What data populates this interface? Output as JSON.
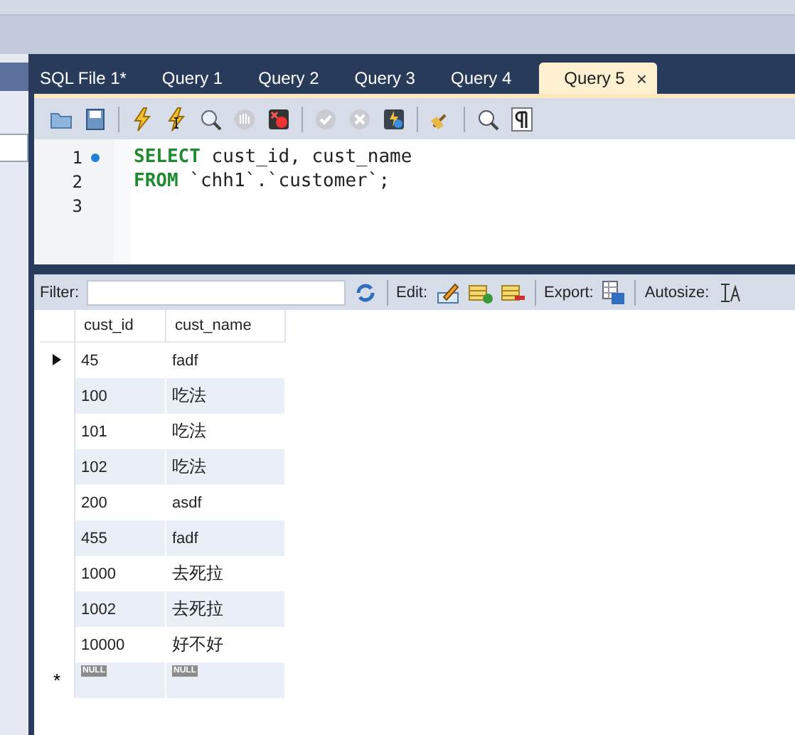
{
  "tabs": [
    {
      "label": "SQL File 1*",
      "selected": false
    },
    {
      "label": "Query 1",
      "selected": false
    },
    {
      "label": "Query 2",
      "selected": false
    },
    {
      "label": "Query 3",
      "selected": false
    },
    {
      "label": "Query 4",
      "selected": false
    },
    {
      "label": "Query 5",
      "selected": true,
      "close": "×"
    }
  ],
  "editor": {
    "lines": [
      {
        "number": "1",
        "marker": true,
        "tokens": [
          {
            "kind": "keyword",
            "text": "SELECT"
          },
          {
            "kind": "plain",
            "text": " cust_id, cust_name"
          }
        ]
      },
      {
        "number": "2",
        "marker": false,
        "tokens": [
          {
            "kind": "keyword",
            "text": "FROM"
          },
          {
            "kind": "plain",
            "text": " `chh1`.`customer`;"
          }
        ]
      },
      {
        "number": "3",
        "marker": false
      }
    ]
  },
  "results_toolbar": {
    "filter_label": "Filter:",
    "edit_label": "Edit:",
    "export_label": "Export:",
    "autosize_label": "Autosize:"
  },
  "table": {
    "columns": [
      "cust_id",
      "cust_name"
    ],
    "rows": [
      {
        "cells": [
          "45",
          "fadf"
        ],
        "selected": true
      },
      {
        "cells": [
          "100",
          "吃法"
        ],
        "selected": false
      },
      {
        "cells": [
          "101",
          "吃法"
        ],
        "selected": false
      },
      {
        "cells": [
          "102",
          "吃法"
        ],
        "selected": false
      },
      {
        "cells": [
          "200",
          "asdf"
        ],
        "selected": false
      },
      {
        "cells": [
          "455",
          "fadf"
        ],
        "selected": false
      },
      {
        "cells": [
          "1000",
          "去死拉"
        ],
        "selected": false
      },
      {
        "cells": [
          "1002",
          "去死拉"
        ],
        "selected": false
      },
      {
        "cells": [
          "10000",
          "好不好"
        ],
        "selected": false
      }
    ],
    "new_row": {
      "marker": "*",
      "cells": [
        "NULL",
        "NULL"
      ]
    }
  }
}
